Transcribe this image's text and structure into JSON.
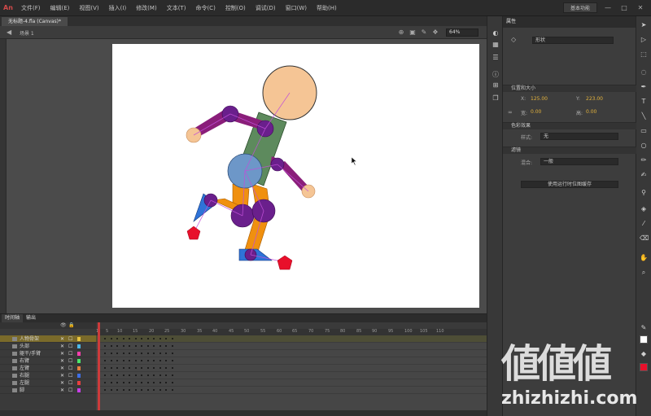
{
  "app": {
    "logo": "An",
    "menu": [
      "文件(F)",
      "编辑(E)",
      "视图(V)",
      "插入(I)",
      "修改(M)",
      "文本(T)",
      "命令(C)",
      "控制(O)",
      "调试(D)",
      "窗口(W)",
      "帮助(H)"
    ],
    "workspace": "基本功能",
    "win_buttons": [
      "—",
      "□",
      "✕"
    ]
  },
  "document": {
    "tab_title": "无标题-4.fla (Canvas)*",
    "scene_label": "场景 1",
    "zoom_value": "64%"
  },
  "properties": {
    "header": "属性",
    "doc_select": "形状",
    "section_position": "位置和大小",
    "x_label": "X:",
    "x_value": "125.00",
    "y_label": "Y:",
    "y_value": "223.00",
    "w_label": "宽:",
    "w_value": "0.00",
    "h_label": "高:",
    "h_value": "0.00",
    "section_color": "色彩效果",
    "style_label": "样式:",
    "style_value": "无",
    "section_filter": "滤镜",
    "blend_label": "混合:",
    "blend_value": "一般",
    "button_label": "使用运行时位图缓存"
  },
  "timeline": {
    "tab_timeline": "时间轴",
    "tab_output": "输出",
    "frame_numbers": [
      "1",
      "5",
      "10",
      "15",
      "20",
      "25",
      "30",
      "35",
      "40",
      "45",
      "50",
      "55",
      "60",
      "65",
      "70",
      "75",
      "80",
      "85",
      "90",
      "95",
      "100",
      "105",
      "110"
    ],
    "layers": [
      {
        "name": "人物骨架",
        "color": "#e8c440",
        "selected": true
      },
      {
        "name": "头部",
        "color": "#4db8e8",
        "selected": false
      },
      {
        "name": "躯干/手臂",
        "color": "#ff3fae",
        "selected": false
      },
      {
        "name": "右臂",
        "color": "#4be86a",
        "selected": false
      },
      {
        "name": "左臂",
        "color": "#e8803f",
        "selected": false
      },
      {
        "name": "右腿",
        "color": "#3f6fe8",
        "selected": false
      },
      {
        "name": "左腿",
        "color": "#e83f3f",
        "selected": false
      },
      {
        "name": "脚",
        "color": "#c83fe8",
        "selected": false
      }
    ]
  },
  "tool_icons": [
    "selection-icon",
    "subselection-icon",
    "free-transform-icon",
    "lasso-icon",
    "pen-icon",
    "text-icon",
    "line-icon",
    "rectangle-icon",
    "oval-icon",
    "pencil-icon",
    "brush-icon",
    "bone-icon",
    "paint-bucket-icon",
    "eyedropper-icon",
    "eraser-icon",
    "hand-icon",
    "zoom-icon",
    "stroke-color-icon",
    "fill-color-icon"
  ],
  "colors": {
    "head": "#f5c595",
    "torso": "#5d8a5d",
    "pelvis": "#6d97c8",
    "arm": "#8a1e7a",
    "joint": "#6a1f8c",
    "leg": "#f0900f",
    "foot": "#2f73d8",
    "marker": "#e8102b"
  },
  "watermark": {
    "chars": "値値値",
    "url": "zhizhizhi.com"
  }
}
